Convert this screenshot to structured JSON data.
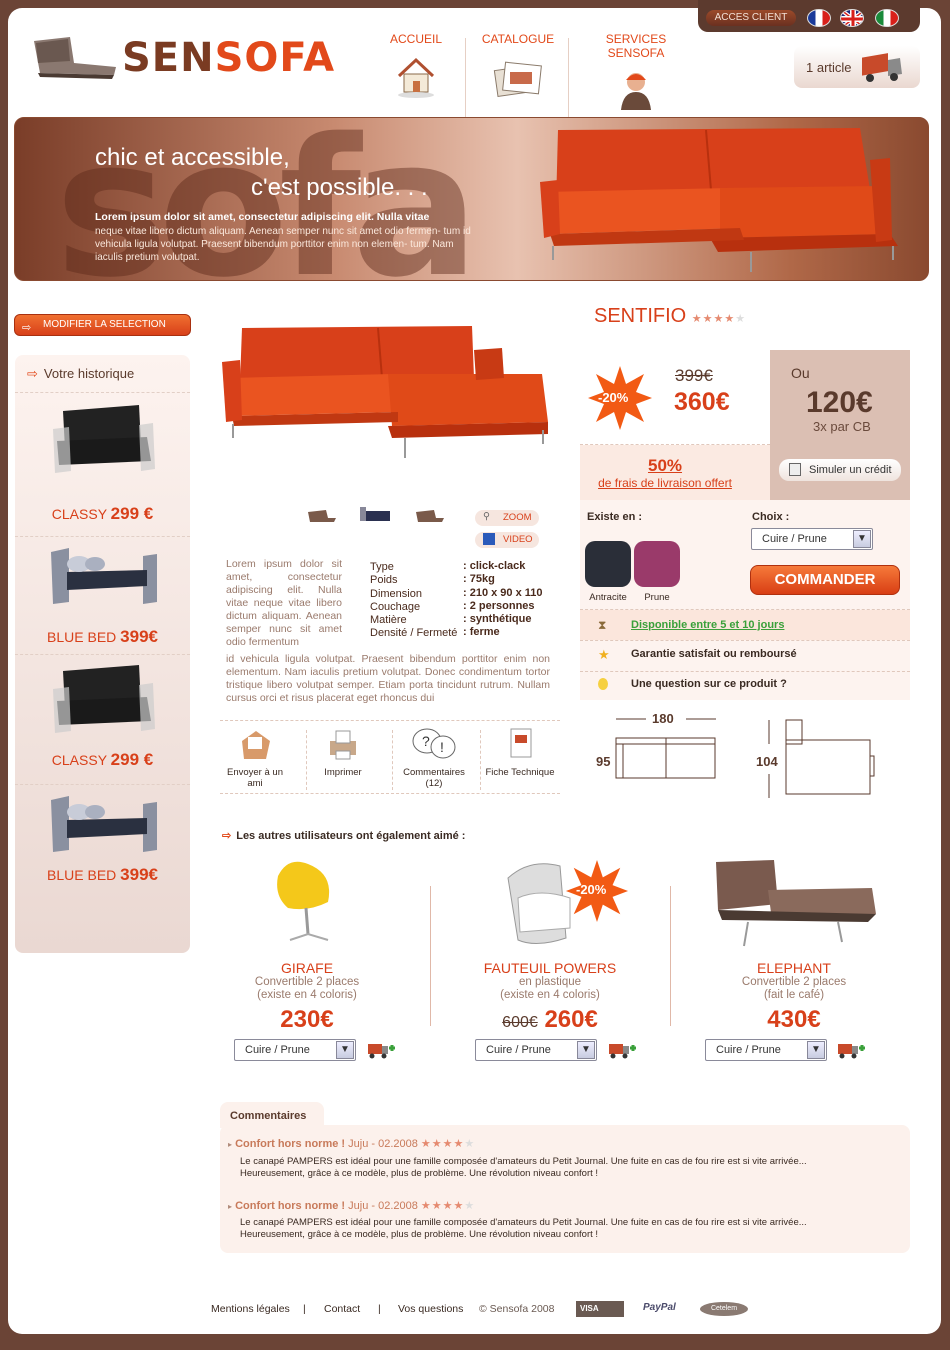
{
  "header": {
    "acces_client": "ACCES CLIENT",
    "logo_a": "SEN",
    "logo_b": "SOFA",
    "nav": [
      {
        "label": "ACCUEIL"
      },
      {
        "label": "CATALOGUE"
      },
      {
        "label": "SERVICES SENSOFA"
      }
    ],
    "cart": "1 article"
  },
  "banner": {
    "watermark": "sofa",
    "line1": "chic et accessible,",
    "line2": "c'est possible. . .",
    "lead": "Lorem ipsum dolor sit amet, consectetur adipiscing elit. Nulla vitae",
    "text": "neque vitae libero dictum aliquam. Aenean semper nunc sit amet odio fermen- tum id vehicula ligula volutpat. Praesent bibendum porttitor enim non elemen- tum. Nam iaculis pretium volutpat."
  },
  "sidebar": {
    "modify": "MODIFIER LA SELECTION",
    "history_title": "Votre historique",
    "items": [
      {
        "name": "CLASSY",
        "price": "299 €"
      },
      {
        "name": "BLUE BED",
        "price": "399€"
      },
      {
        "name": "CLASSY",
        "price": "299 €"
      },
      {
        "name": "BLUE BED",
        "price": "399€"
      }
    ]
  },
  "product": {
    "name": "SENTIFIO",
    "rating": "★★★★",
    "rating_empty": "★",
    "discount": "-20%",
    "old_price": "399€",
    "price": "360€",
    "or_label": "Ou",
    "installment": "120€",
    "installment_note": "3x par CB",
    "credit_btn": "Simuler un crédit",
    "delivery_pct": "50%",
    "delivery_text": "de frais de livraison offert",
    "zoom": "ZOOM",
    "video": "VIDEO",
    "colors_label": "Existe en :",
    "colors": [
      {
        "name": "Antracite",
        "color": "#2a2e38"
      },
      {
        "name": "Prune",
        "color": "#9a3a6a"
      }
    ],
    "choice_label": "Choix :",
    "choice_value": "Cuire / Prune",
    "order_btn": "COMMANDER",
    "info": [
      {
        "text": "Disponible entre 5 et 10 jours",
        "icon": "hourglass-icon"
      },
      {
        "text": "Garantie satisfait ou remboursé",
        "icon": "star-icon"
      },
      {
        "text": "Une question sur ce produit ?",
        "icon": "bulb-icon"
      }
    ],
    "desc_col": "Lorem ipsum dolor sit amet, consectetur adipiscing elit. Nulla vitae neque vitae libero dictum aliquam. Aenean semper nunc sit amet odio fermentum",
    "desc_full": "id vehicula ligula volutpat. Praesent bibendum porttitor enim non elementum. Nam iaculis pretium volutpat. Donec condimentum tortor tristique libero volutpat semper. Etiam porta tincidunt rutrum. Nullam cursus orci et risus placerat eget rhoncus dui",
    "specs": [
      {
        "k": "Type",
        "v": ": click-clack"
      },
      {
        "k": "Poids",
        "v": ": 75kg"
      },
      {
        "k": "Dimension",
        "v": ": 210 x 90 x 110"
      },
      {
        "k": "Couchage",
        "v": ": 2 personnes"
      },
      {
        "k": "Matière",
        "v": ": synthétique"
      },
      {
        "k": "Densité / Fermeté",
        "v": ": ferme"
      }
    ],
    "tools": [
      {
        "label": "Envoyer à un ami"
      },
      {
        "label": "Imprimer"
      },
      {
        "label": "Commentaires (12)"
      },
      {
        "label": "Fiche Technique"
      }
    ],
    "dims": {
      "w": "180",
      "h": "95",
      "d": "104"
    }
  },
  "related": {
    "title": "Les autres utilisateurs ont également aimé :",
    "items": [
      {
        "name": "GIRAFE",
        "sub1": "Convertible 2 places",
        "sub2": "(existe en 4 coloris)",
        "old": "",
        "price": "230€",
        "select": "Cuire / Prune"
      },
      {
        "name": "FAUTEUIL POWERS",
        "sub1": "en plastique",
        "sub2": "(existe en 4 coloris)",
        "old": "600€",
        "price": "260€",
        "select": "Cuire / Prune",
        "badge": "-20%"
      },
      {
        "name": "ELEPHANT",
        "sub1": "Convertible 2 places",
        "sub2": "(fait le café)",
        "old": "",
        "price": "430€",
        "select": "Cuire / Prune"
      }
    ]
  },
  "comments": {
    "tab": "Commentaires",
    "items": [
      {
        "title": "Confort hors norme !",
        "meta": "Juju - 02.2008",
        "stars": "★★★★",
        "empty": "★",
        "body1": "Le canapé PAMPERS est idéal pour une famille composée d'amateurs du Petit Journal. Une fuite en cas de fou rire est si vite arrivée...",
        "body2": "Heureusement, grâce à ce modèle, plus de problème. Une révolution niveau confort  !"
      },
      {
        "title": "Confort hors norme !",
        "meta": "Juju - 02.2008",
        "stars": "★★★★",
        "empty": "★",
        "body1": "Le canapé PAMPERS est idéal pour une famille composée d'amateurs du Petit Journal. Une fuite en cas de fou rire est si vite arrivée...",
        "body2": "Heureusement, grâce à ce modèle, plus de problème. Une révolution niveau confort  !"
      }
    ]
  },
  "footer": {
    "links": [
      "Mentions légales",
      "Contact",
      "Vos questions"
    ],
    "copyright": "© Sensofa 2008",
    "sep": "|",
    "payments": [
      "VISA",
      "PayPal",
      "Cetelem"
    ]
  }
}
